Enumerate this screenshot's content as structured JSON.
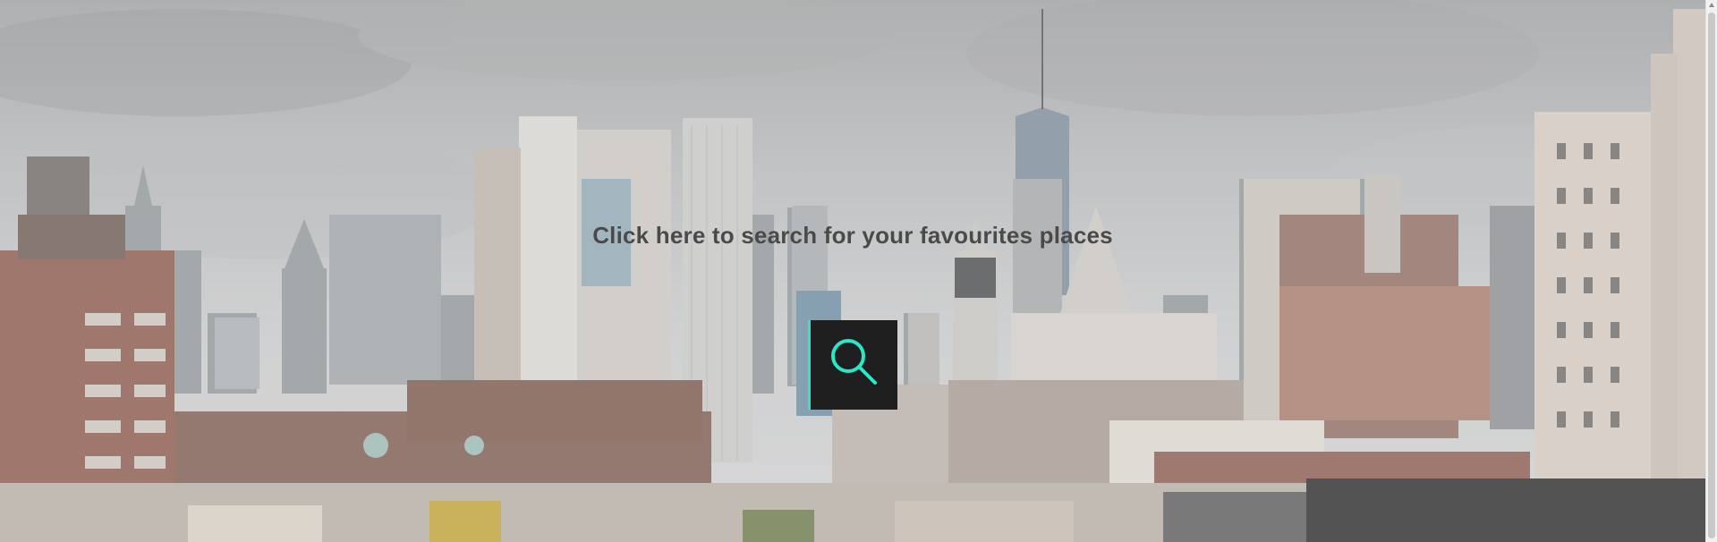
{
  "hero": {
    "background_image": "new-york-city-skyline",
    "headline": "Click here to search for your favourites places"
  },
  "search_button": {
    "icon": "search-icon",
    "background_color": "#1f1f1f",
    "accent_color": "#2ee6c6"
  }
}
